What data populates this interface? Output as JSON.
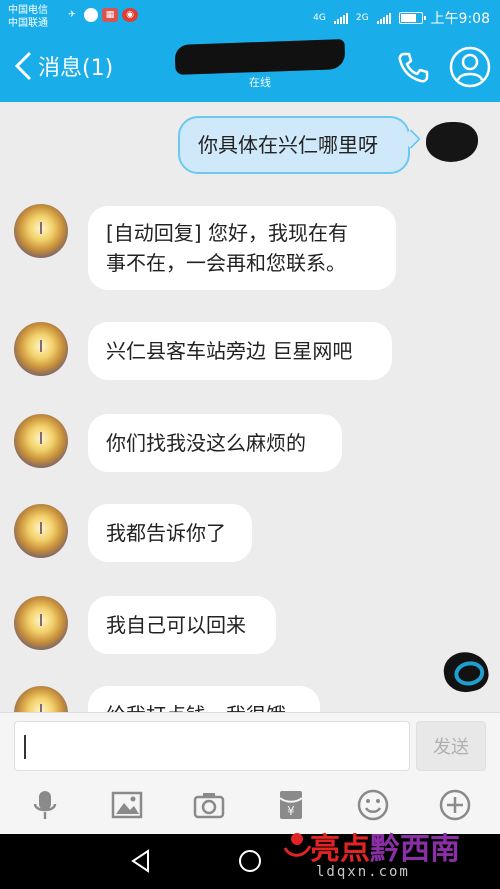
{
  "status_bar": {
    "carrier_1": "中国电信",
    "carrier_2": "中国联通",
    "network_1": "4G",
    "network_2": "2G",
    "time": "上午9:08",
    "battery_level": 0.8
  },
  "header": {
    "back_label": "消息(1)",
    "presence": "在线"
  },
  "messages": [
    {
      "direction": "out",
      "text": "你具体在兴仁哪里呀"
    },
    {
      "direction": "in",
      "lines": [
        "[自动回复] 您好，我现在有",
        "事不在，一会再和您联系。"
      ]
    },
    {
      "direction": "in",
      "text": "兴仁县客车站旁边 巨星网吧"
    },
    {
      "direction": "in",
      "text": "你们找我没这么麻烦的"
    },
    {
      "direction": "in",
      "text": "我都告诉你了"
    },
    {
      "direction": "in",
      "text": "我自己可以回来"
    },
    {
      "direction": "in",
      "text": "给我打点钱，我很饿"
    }
  ],
  "input": {
    "value": "",
    "send_label": "发送"
  },
  "watermark": {
    "text_a": "亮点",
    "text_b": "黔西南",
    "url": "ldqxn.com"
  },
  "colors": {
    "accent": "#19aee9",
    "outgoing_bubble": "#cfe9fb",
    "outgoing_border": "#6cc8f2"
  }
}
